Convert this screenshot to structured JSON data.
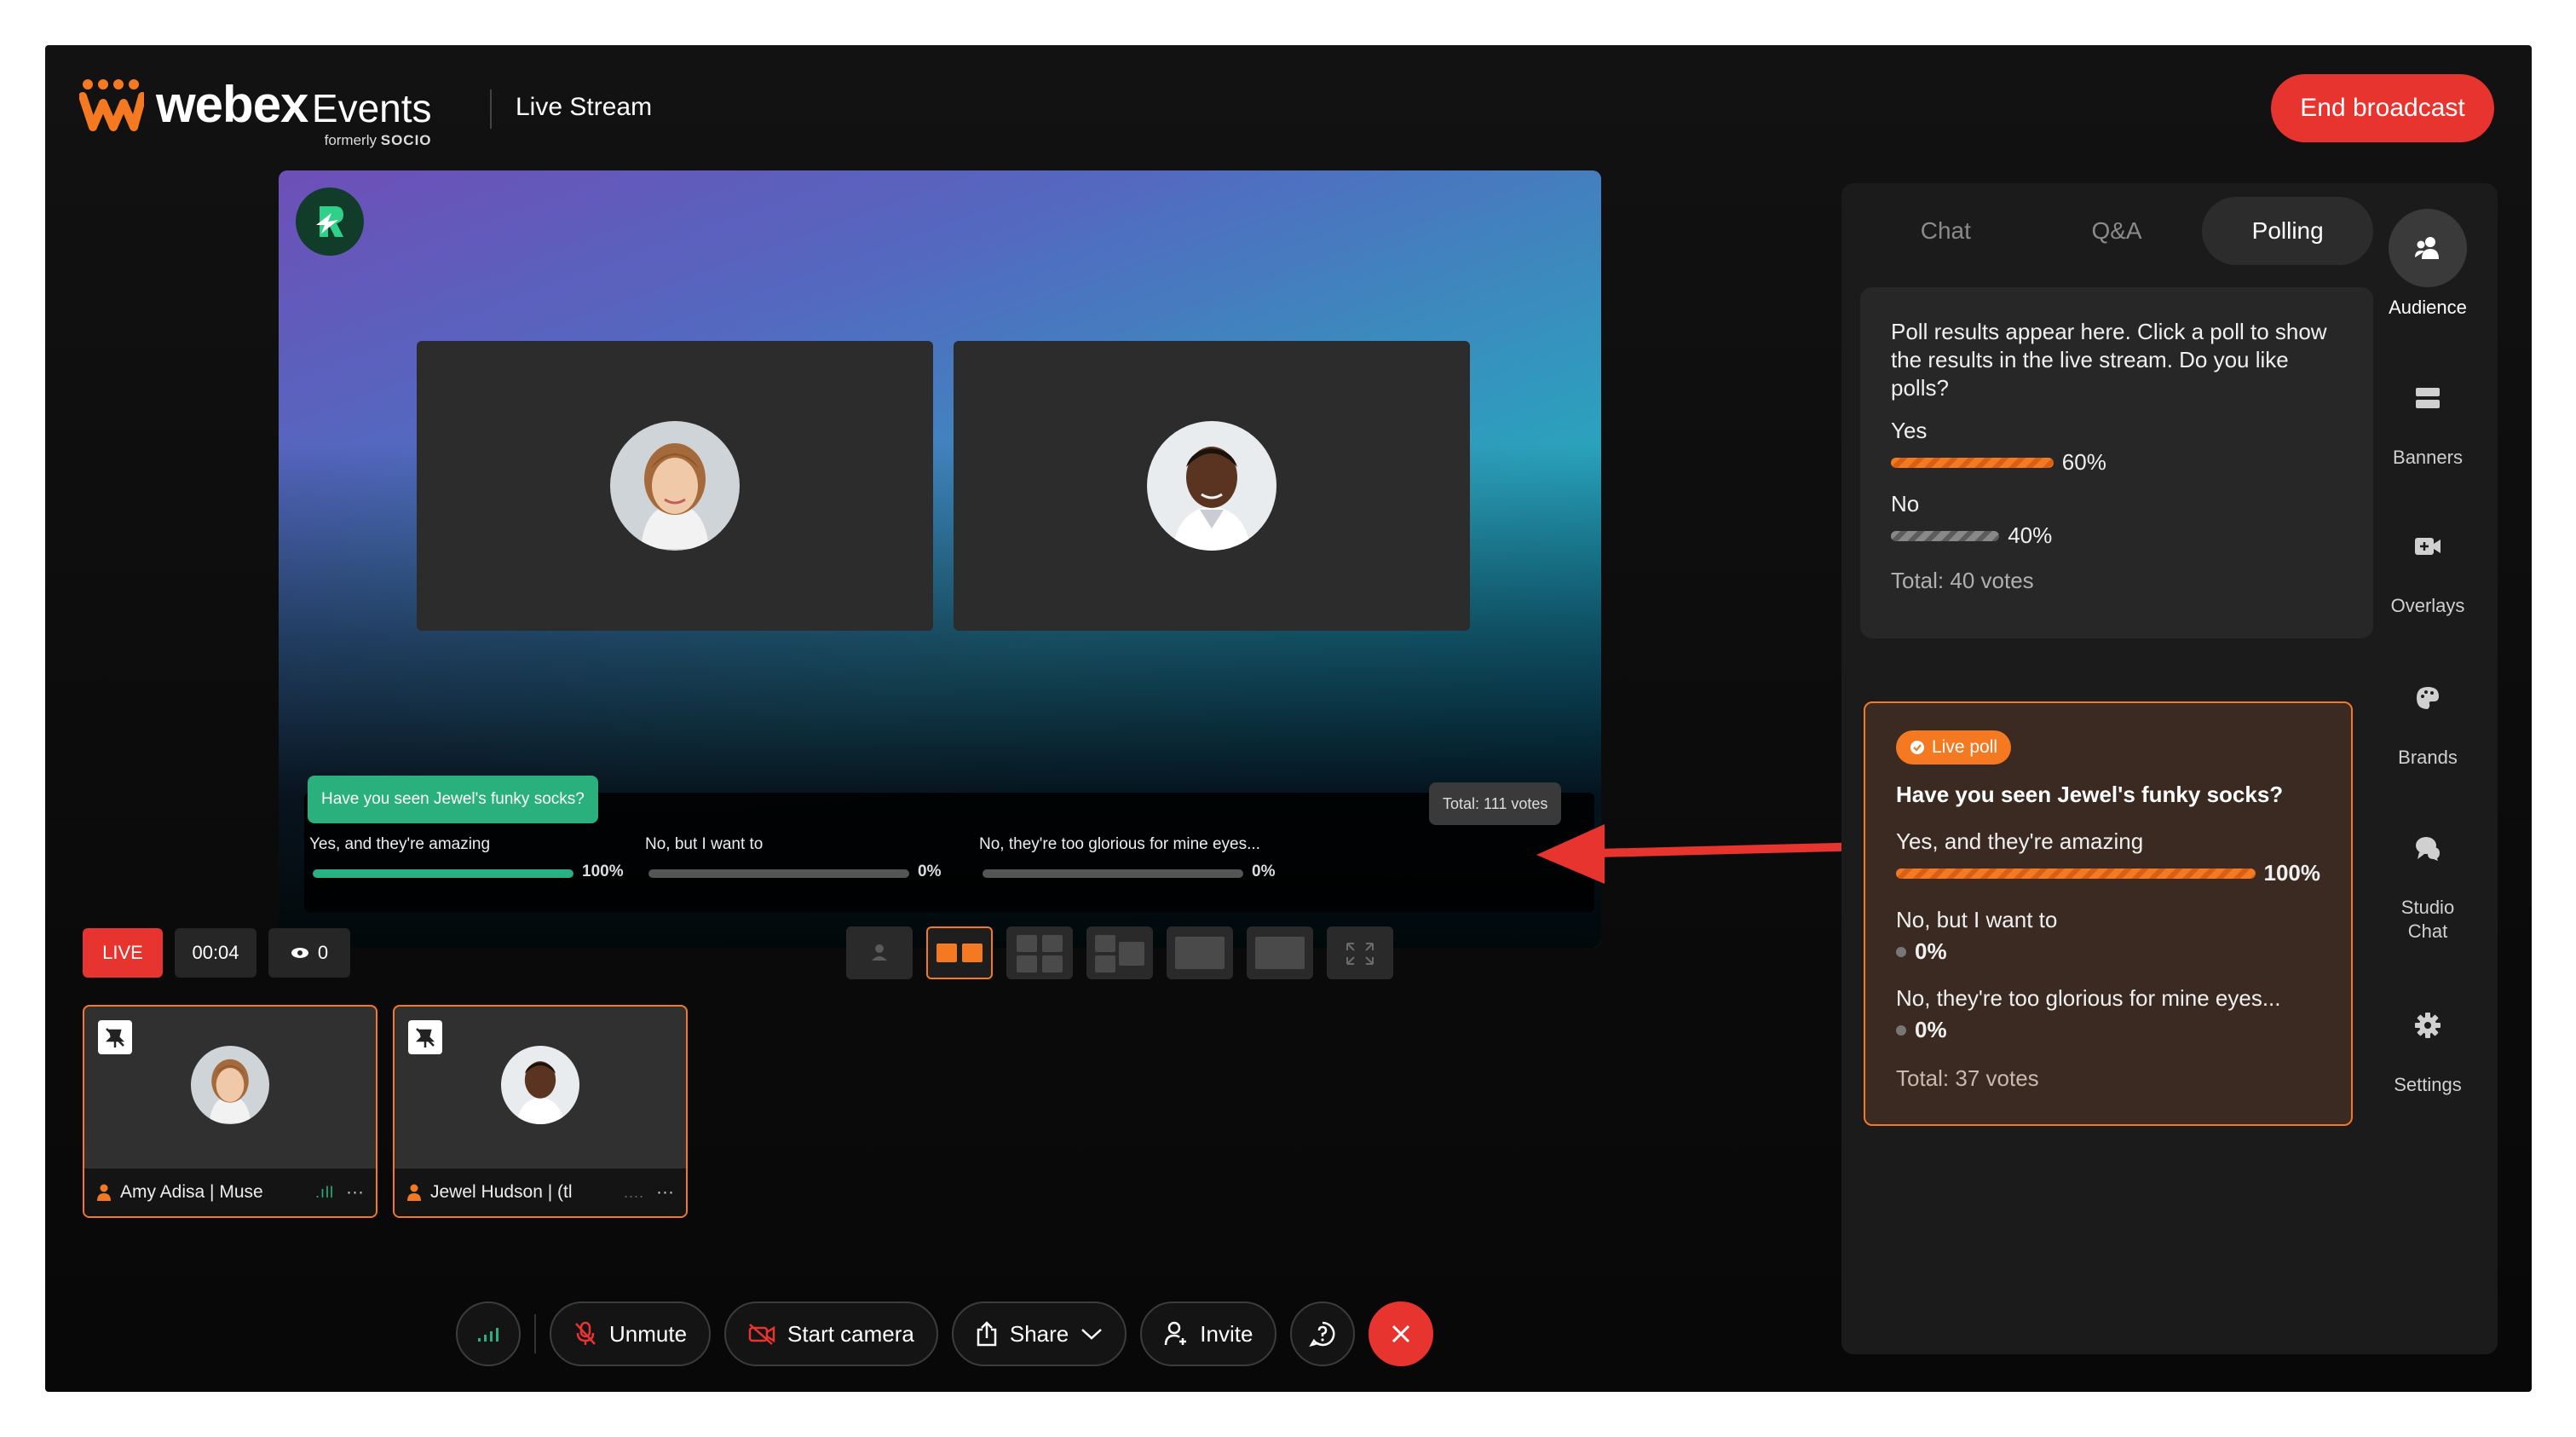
{
  "header": {
    "brand": "webex",
    "brand_suffix": "Events",
    "formerly": "formerly",
    "formerly_brand": "SOCIO",
    "title": "Live Stream",
    "end_broadcast": "End broadcast"
  },
  "stage": {
    "poll_question": "Have you seen Jewel's funky socks?",
    "poll_total": "Total: 111 votes",
    "options": [
      {
        "label": "Yes, and they're amazing",
        "percent": "100%",
        "value": 1.0
      },
      {
        "label": "No, but I want to",
        "percent": "0%",
        "value": 0.0
      },
      {
        "label": "No, they're too glorious for mine eyes...",
        "percent": "0%",
        "value": 0.0
      }
    ]
  },
  "status": {
    "live": "LIVE",
    "timer": "00:04",
    "viewers": "0"
  },
  "participants": [
    {
      "name": "Amy Adisa | Muse",
      "icon": "person-icon"
    },
    {
      "name": "Jewel Hudson | (tl",
      "icon": "person-icon"
    }
  ],
  "controls": {
    "unmute": "Unmute",
    "start_camera": "Start camera",
    "share": "Share",
    "invite": "Invite"
  },
  "panel": {
    "tabs": [
      "Chat",
      "Q&A",
      "Polling"
    ],
    "active_tab": "Polling",
    "poll1": {
      "description": "Poll results appear here. Click a poll to show the results in the live stream. Do you like polls?",
      "options": [
        {
          "label": "Yes",
          "percent": "60%",
          "value": 0.6
        },
        {
          "label": "No",
          "percent": "40%",
          "value": 0.4
        }
      ],
      "total": "Total: 40 votes"
    },
    "poll2": {
      "badge": "Live poll",
      "question": "Have you seen Jewel's funky socks?",
      "options": [
        {
          "label": "Yes, and they're amazing",
          "percent": "100%",
          "value": 1.0
        },
        {
          "label": "No, but I want to",
          "percent": "0%",
          "value": 0.0
        },
        {
          "label": "No, they're too glorious for mine eyes...",
          "percent": "0%",
          "value": 0.0
        }
      ],
      "total": "Total: 37 votes"
    }
  },
  "sidenav": {
    "audience": "Audience",
    "banners": "Banners",
    "overlays": "Overlays",
    "brands": "Brands",
    "studio_chat_1": "Studio",
    "studio_chat_2": "Chat",
    "settings": "Settings"
  },
  "colors": {
    "accent": "#f47920",
    "danger": "#e8342f",
    "poll_green": "#2ab07c",
    "panel_bg": "#1b1b1b"
  }
}
